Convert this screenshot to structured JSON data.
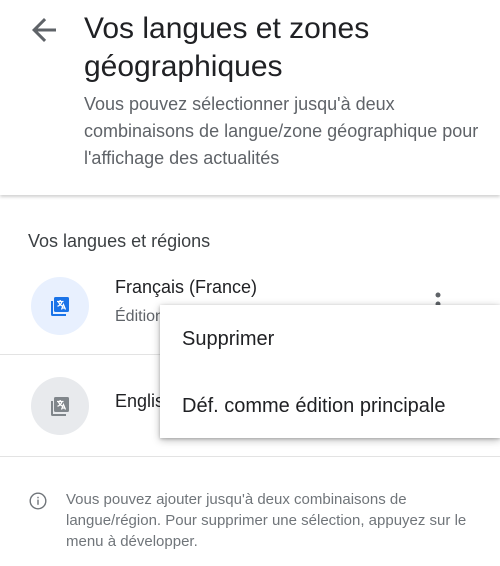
{
  "header": {
    "title": "Vos langues et zones géographiques",
    "subtitle": "Vous pouvez sélectionner jusqu'à deux combinaisons de langue/zone géographique pour l'affichage des actualités"
  },
  "icons": {
    "back": "arrow-back-icon",
    "language": "translate-icon",
    "more": "more-vert-icon",
    "info": "info-icon"
  },
  "section": {
    "title": "Vos langues et régions"
  },
  "languages": [
    {
      "name": "Français (France)",
      "subtitle": "Édition"
    },
    {
      "name": "Englis",
      "subtitle": ""
    }
  ],
  "menu": {
    "items": [
      {
        "label": "Supprimer"
      },
      {
        "label": "Déf. comme édition principale"
      }
    ]
  },
  "info": {
    "text": "Vous pouvez ajouter jusqu'à deux combinaisons de langue/région. Pour supprimer une sélection, appuyez sur le menu à développer."
  },
  "colors": {
    "accent_blue": "#1a73e8",
    "avatar_blue_bg": "#e8f0fe",
    "avatar_grey_bg": "#e8eaed",
    "icon_grey": "#80868b",
    "text_primary": "#202124",
    "text_secondary": "#5f6368"
  }
}
